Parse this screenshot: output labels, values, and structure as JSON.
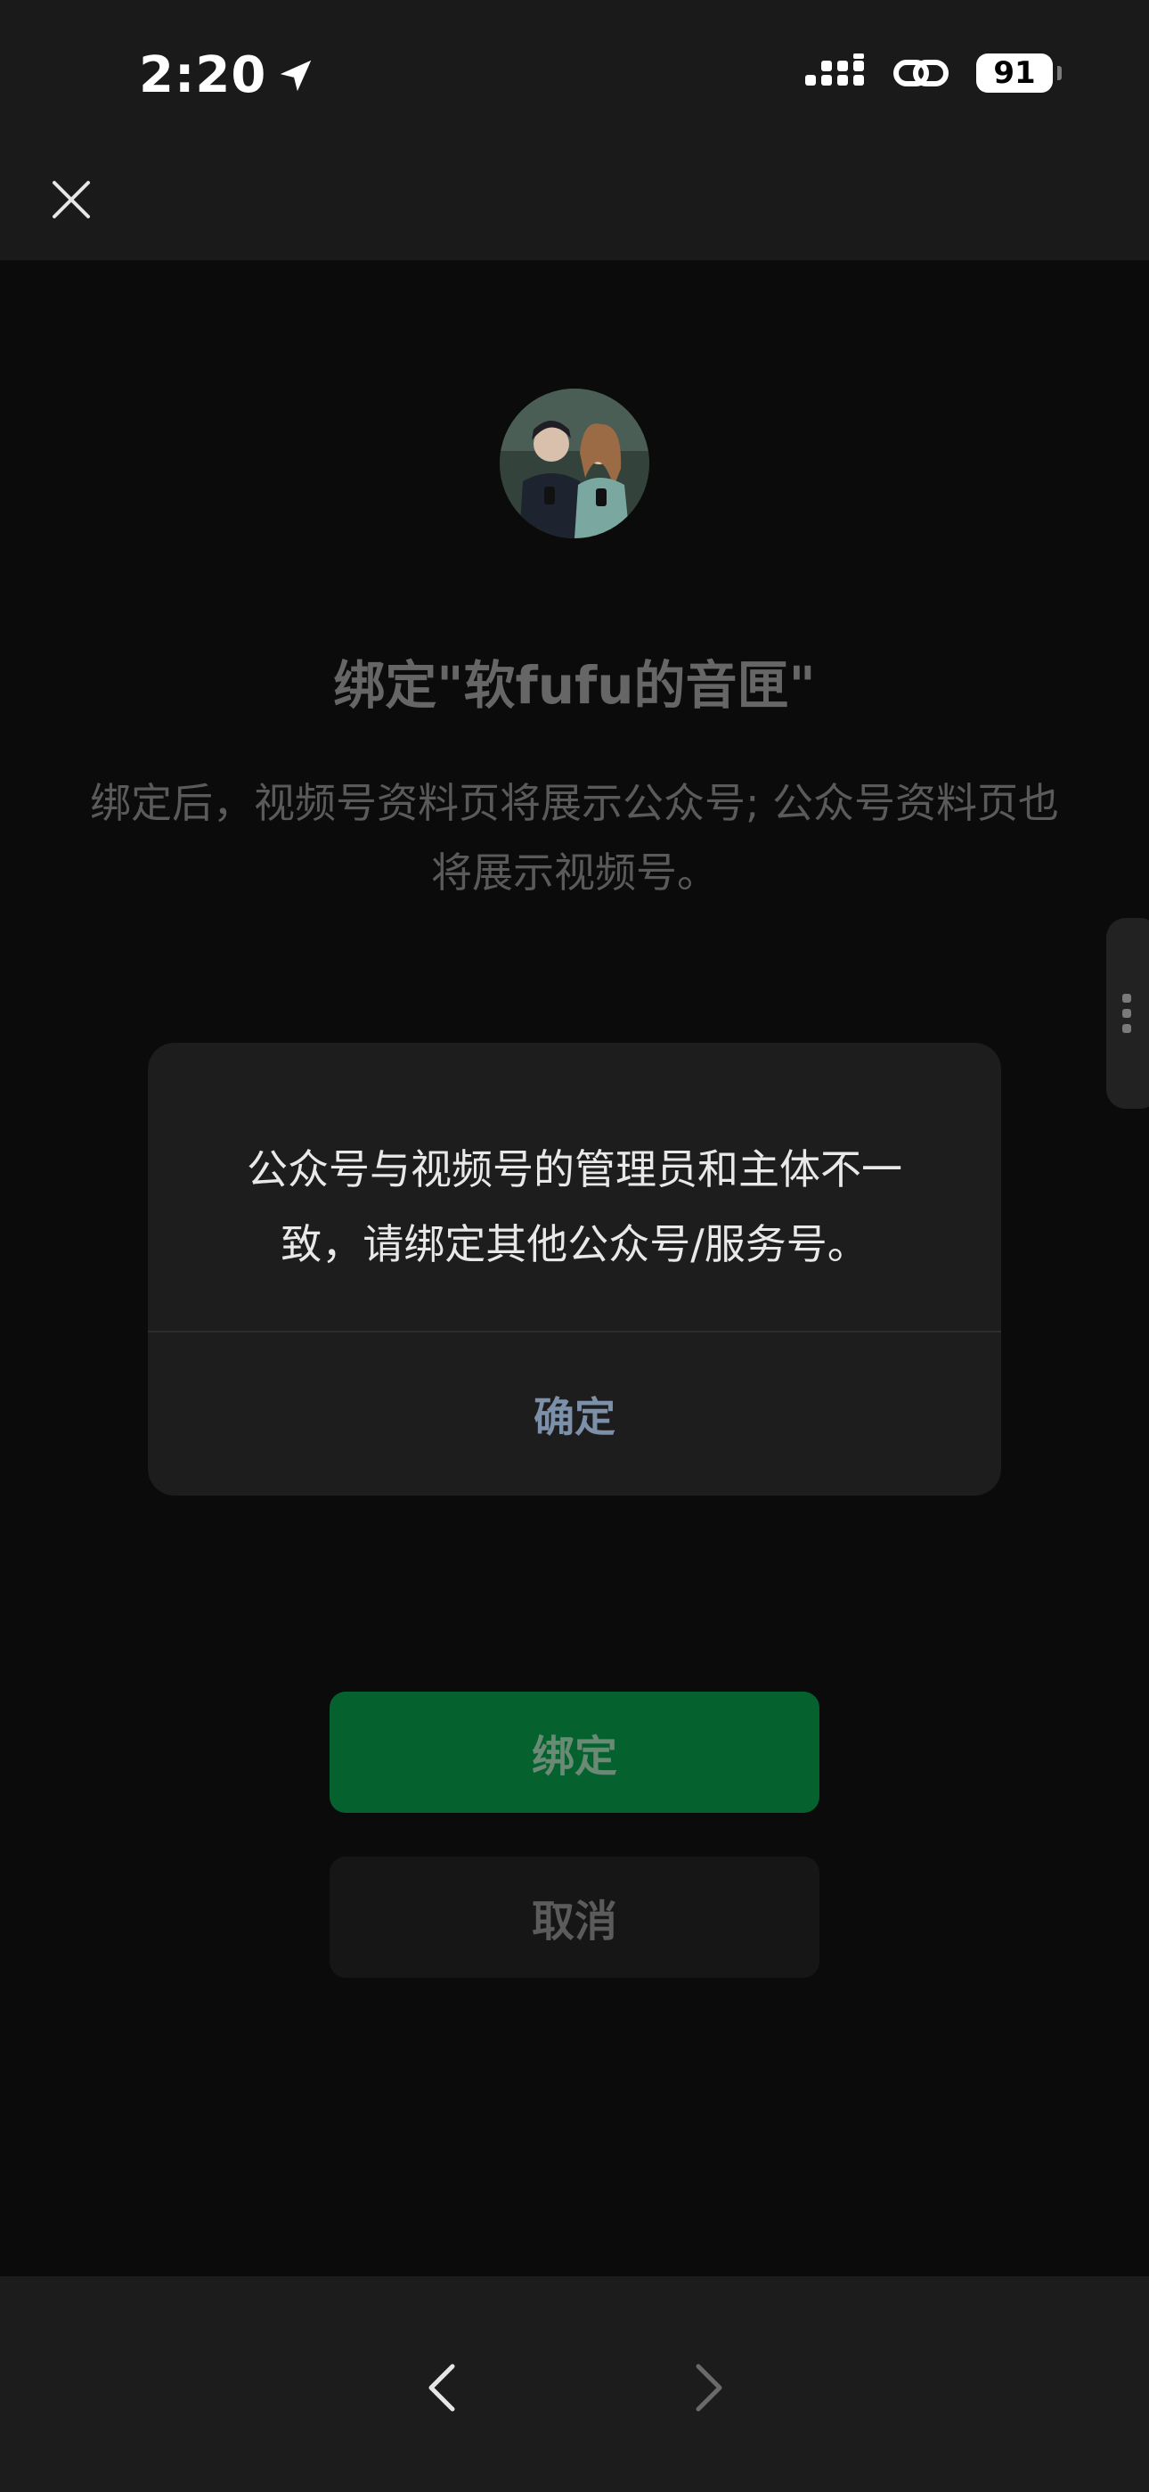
{
  "status_bar": {
    "time": "2:20",
    "battery": "91"
  },
  "icons": {
    "location": "location-arrow-icon",
    "signal": "cellular-signal-icon",
    "link": "link-icon",
    "close": "close-icon",
    "back": "chevron-left-icon",
    "forward": "chevron-right-icon",
    "handle": "vertical-dots-icon"
  },
  "main": {
    "title": "绑定\"软fufu的音匣\"",
    "description": "绑定后，视频号资料页将展示公众号; 公众号资料页也将展示视频号。"
  },
  "dialog": {
    "message": "公众号与视频号的管理员和主体不一致，请绑定其他公众号/服务号。",
    "confirm_label": "确定"
  },
  "actions": {
    "bind_label": "绑定",
    "cancel_label": "取消"
  },
  "colors": {
    "bind_button": "#05622f",
    "dialog_link": "#7d90aa"
  }
}
